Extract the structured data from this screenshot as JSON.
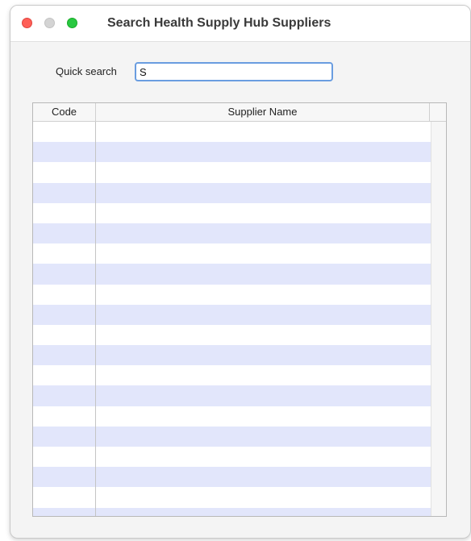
{
  "window": {
    "title": "Search Health Supply Hub Suppliers"
  },
  "search": {
    "label": "Quick search",
    "value": "S"
  },
  "table": {
    "columns": [
      "Code",
      "Supplier Name"
    ],
    "rows": [
      [
        "",
        ""
      ],
      [
        "",
        ""
      ],
      [
        "",
        ""
      ],
      [
        "",
        ""
      ],
      [
        "",
        ""
      ],
      [
        "",
        ""
      ],
      [
        "",
        ""
      ],
      [
        "",
        ""
      ],
      [
        "",
        ""
      ],
      [
        "",
        ""
      ],
      [
        "",
        ""
      ],
      [
        "",
        ""
      ],
      [
        "",
        ""
      ],
      [
        "",
        ""
      ],
      [
        "",
        ""
      ],
      [
        "",
        ""
      ],
      [
        "",
        ""
      ],
      [
        "",
        ""
      ],
      [
        "",
        ""
      ],
      [
        "",
        ""
      ]
    ]
  },
  "colors": {
    "row_alt": "#e2e6fb",
    "focus_ring": "#6a9de0",
    "close": "#fe5f57",
    "minimize": "#d4d4d4",
    "zoom": "#28c840"
  }
}
